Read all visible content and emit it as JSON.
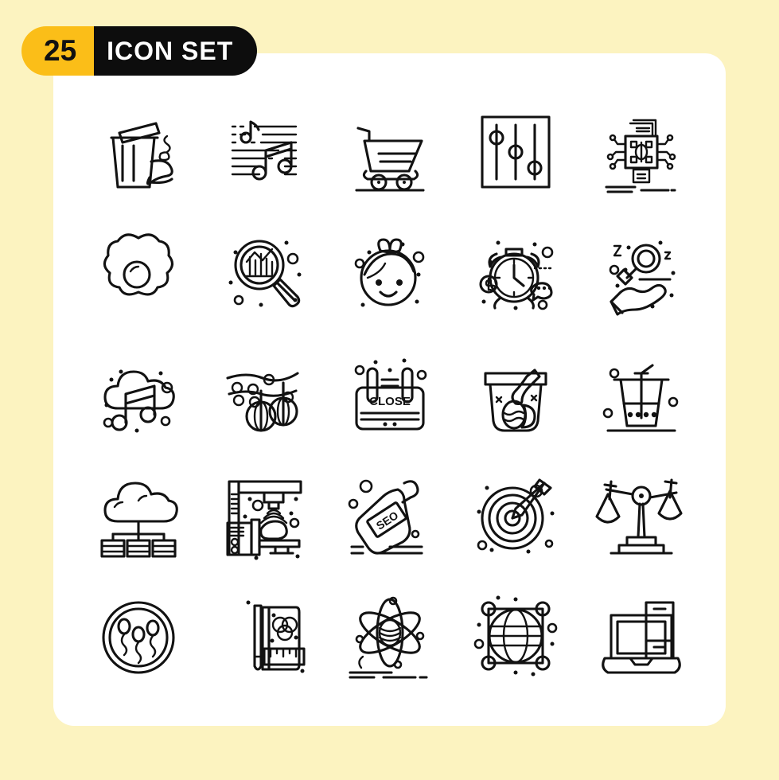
{
  "page": {
    "background_color": "#FCF3C0",
    "card_color": "#FFFFFF"
  },
  "badge": {
    "count": "25",
    "title": "ICON SET",
    "count_bg": "#FBBE18",
    "count_fg": "#111111",
    "title_bg": "#0D0D0D",
    "title_fg": "#FFFFFF"
  },
  "grid": {
    "columns": 5,
    "rows": 5,
    "total": 25,
    "stroke_color": "#121212"
  },
  "icons": [
    {
      "name": "trash-bin-icon",
      "label": "Trash Bin"
    },
    {
      "name": "music-sheet-icon",
      "label": "Music Sheet"
    },
    {
      "name": "shopping-cart-icon",
      "label": "Shopping Cart"
    },
    {
      "name": "equalizer-sliders-icon",
      "label": "Settings Sliders"
    },
    {
      "name": "ai-processor-chip-icon",
      "label": "AI Processor"
    },
    {
      "name": "fried-egg-icon",
      "label": "Fried Egg"
    },
    {
      "name": "data-analysis-search-icon",
      "label": "Data Analysis"
    },
    {
      "name": "girl-emoji-icon",
      "label": "Girl Emoji"
    },
    {
      "name": "alarm-money-time-icon",
      "label": "Time Is Money"
    },
    {
      "name": "hand-search-sleep-icon",
      "label": "Hand Search"
    },
    {
      "name": "cloud-music-icon",
      "label": "Cloud Music"
    },
    {
      "name": "party-lanterns-icon",
      "label": "Party Lanterns"
    },
    {
      "name": "close-sign-icon",
      "label": "Close Sign"
    },
    {
      "name": "easter-basket-icon",
      "label": "Easter Basket"
    },
    {
      "name": "drink-cup-straw-icon",
      "label": "Cold Drink"
    },
    {
      "name": "cloud-network-icon",
      "label": "Cloud Network"
    },
    {
      "name": "medical-scanner-icon",
      "label": "Medical Scanner"
    },
    {
      "name": "seo-bottle-tag-icon",
      "label": "SEO Tag"
    },
    {
      "name": "target-dart-icon",
      "label": "Target Dart"
    },
    {
      "name": "balance-scales-icon",
      "label": "Balance Scales"
    },
    {
      "name": "sperm-fertility-icon",
      "label": "Fertility"
    },
    {
      "name": "design-book-icon",
      "label": "Design Book"
    },
    {
      "name": "atom-database-icon",
      "label": "Data Science"
    },
    {
      "name": "globe-network-icon",
      "label": "Global Network"
    },
    {
      "name": "laptop-desktop-icon",
      "label": "Computer"
    }
  ],
  "icon_text": {
    "close_sign": "CLOSE",
    "seo_tag": "SEO"
  }
}
